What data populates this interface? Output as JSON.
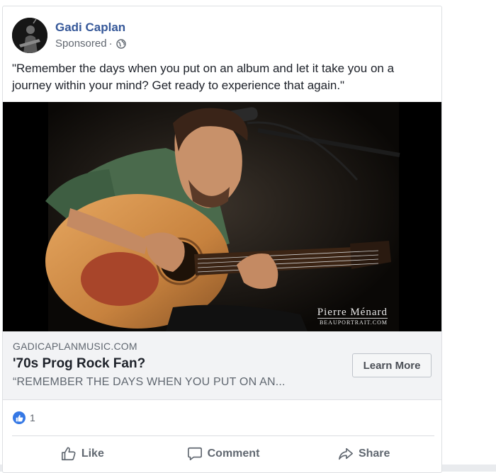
{
  "post": {
    "page_name": "Gadi Caplan",
    "sponsored_label": "Sponsored",
    "separator": "·",
    "privacy_icon": "globe-icon",
    "text": "\"Remember the days when you put on an album and let it take you on a journey within your mind? Get ready to experience that again.\""
  },
  "media": {
    "watermark_name": "Pierre Ménard",
    "watermark_site": "BEAUPORTRAIT.COM"
  },
  "link_preview": {
    "domain": "GADICAPLANMUSIC.COM",
    "headline": "'70s Prog Rock Fan?",
    "description": "“REMEMBER THE DAYS WHEN YOU PUT ON AN...",
    "cta_label": "Learn More"
  },
  "reactions": {
    "icon": "like-reaction-icon",
    "count": "1"
  },
  "actions": {
    "like": "Like",
    "comment": "Comment",
    "share": "Share"
  },
  "colors": {
    "page_name": "#365899",
    "like_blue": "#3578e5",
    "secondary_text": "#606770"
  }
}
